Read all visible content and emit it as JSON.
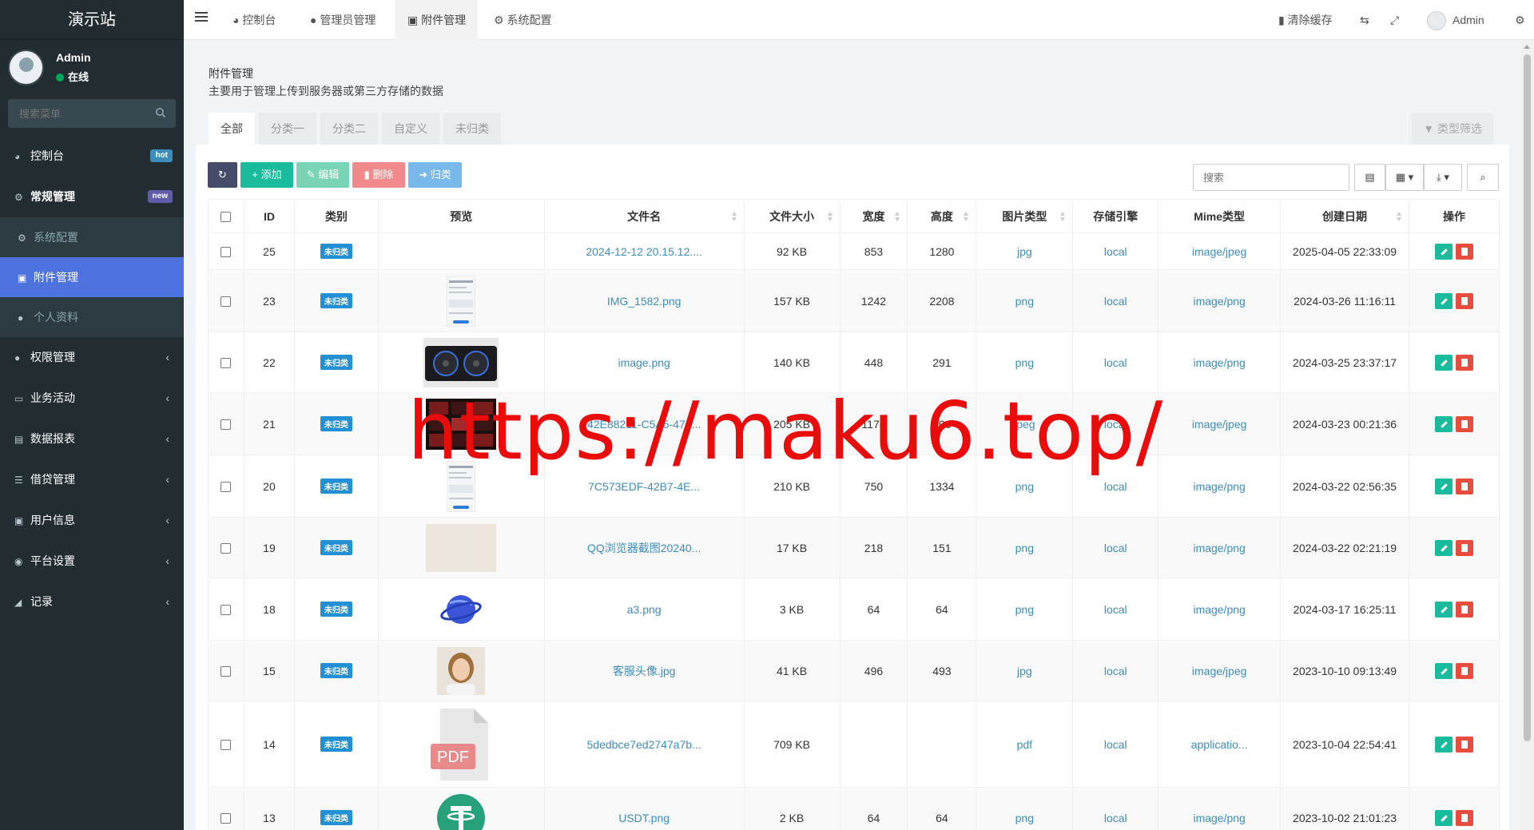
{
  "app": {
    "title": "演示站",
    "user_name": "Admin",
    "user_status": "在线"
  },
  "sidebar": {
    "search_placeholder": "搜索菜单",
    "items": [
      {
        "label": "控制台",
        "icon": "dashboard-icon",
        "badge": "hot"
      },
      {
        "label": "常规管理",
        "icon": "cogs-icon",
        "badge": "new"
      },
      {
        "label": "系统配置",
        "icon": "gear-icon"
      },
      {
        "label": "附件管理",
        "icon": "file-image-icon"
      },
      {
        "label": "个人资料",
        "icon": "user-icon"
      },
      {
        "label": "权限管理",
        "icon": "group-icon"
      },
      {
        "label": "业务活动",
        "icon": "id-card-icon"
      },
      {
        "label": "数据报表",
        "icon": "file-icon"
      },
      {
        "label": "借贷管理",
        "icon": "list-icon"
      },
      {
        "label": "用户信息",
        "icon": "address-book-icon"
      },
      {
        "label": "平台设置",
        "icon": "dot-circle-icon"
      },
      {
        "label": "记录",
        "icon": "area-chart-icon"
      }
    ]
  },
  "navbar": {
    "tabs": [
      {
        "label": "控制台",
        "icon": "dashboard-icon"
      },
      {
        "label": "管理员管理",
        "icon": "user-icon"
      },
      {
        "label": "附件管理",
        "icon": "file-image-icon"
      },
      {
        "label": "系统配置",
        "icon": "gear-icon"
      }
    ],
    "clear_cache": "清除缓存",
    "user": "Admin"
  },
  "page": {
    "title": "附件管理",
    "description": "主要用于管理上传到服务器或第三方存储的数据",
    "category_tabs": [
      "全部",
      "分类一",
      "分类二",
      "自定义",
      "未归类"
    ],
    "type_filter": "类型筛选",
    "toolbar": {
      "add": "添加",
      "edit": "编辑",
      "delete": "删除",
      "classify": "归类"
    },
    "search_placeholder": "搜索"
  },
  "table": {
    "columns": [
      "ID",
      "类别",
      "预览",
      "文件名",
      "文件大小",
      "宽度",
      "高度",
      "图片类型",
      "存储引擎",
      "Mime类型",
      "创建日期",
      "操作"
    ],
    "rows": [
      {
        "id": "25",
        "category": "未归类",
        "preview": "none",
        "filename": "2024-12-12 20.15.12....",
        "size": "92 KB",
        "width": "853",
        "height": "1280",
        "type": "jpg",
        "storage": "local",
        "mime": "image/jpeg",
        "created": "2025-04-05 22:33:09"
      },
      {
        "id": "23",
        "category": "未归类",
        "preview": "phone-screenshot",
        "filename": "IMG_1582.png",
        "size": "157 KB",
        "width": "1242",
        "height": "2208",
        "type": "png",
        "storage": "local",
        "mime": "image/png",
        "created": "2024-03-26 11:16:11"
      },
      {
        "id": "22",
        "category": "未归类",
        "preview": "graphics-card",
        "filename": "image.png",
        "size": "140 KB",
        "width": "448",
        "height": "291",
        "type": "png",
        "storage": "local",
        "mime": "image/png",
        "created": "2024-03-25 23:37:17"
      },
      {
        "id": "21",
        "category": "未归类",
        "preview": "dark-grid",
        "filename": "42E88211-C5A5-470...",
        "size": "205 KB",
        "width": "1170",
        "height": "806",
        "type": "jpeg",
        "storage": "local",
        "mime": "image/jpeg",
        "created": "2024-03-23 00:21:36"
      },
      {
        "id": "20",
        "category": "未归类",
        "preview": "phone-screenshot",
        "filename": "7C573EDF-42B7-4E...",
        "size": "210 KB",
        "width": "750",
        "height": "1334",
        "type": "png",
        "storage": "local",
        "mime": "image/png",
        "created": "2024-03-22 02:56:35"
      },
      {
        "id": "19",
        "category": "未归类",
        "preview": "beige",
        "filename": "QQ浏览器截图20240...",
        "size": "17 KB",
        "width": "218",
        "height": "151",
        "type": "png",
        "storage": "local",
        "mime": "image/png",
        "created": "2024-03-22 02:21:19"
      },
      {
        "id": "18",
        "category": "未归类",
        "preview": "planet",
        "filename": "a3.png",
        "size": "3 KB",
        "width": "64",
        "height": "64",
        "type": "png",
        "storage": "local",
        "mime": "image/png",
        "created": "2024-03-17 16:25:11"
      },
      {
        "id": "15",
        "category": "未归类",
        "preview": "portrait",
        "filename": "客服头像.jpg",
        "size": "41 KB",
        "width": "496",
        "height": "493",
        "type": "jpg",
        "storage": "local",
        "mime": "image/jpeg",
        "created": "2023-10-10 09:13:49"
      },
      {
        "id": "14",
        "category": "未归类",
        "preview": "pdf",
        "filename": "5dedbce7ed2747a7b...",
        "size": "709 KB",
        "width": "",
        "height": "",
        "type": "pdf",
        "storage": "local",
        "mime": "applicatio...",
        "created": "2023-10-04 22:54:41"
      },
      {
        "id": "13",
        "category": "未归类",
        "preview": "usdt",
        "filename": "USDT.png",
        "size": "2 KB",
        "width": "64",
        "height": "64",
        "type": "png",
        "storage": "local",
        "mime": "image/png",
        "created": "2023-10-02 21:01:23"
      }
    ]
  },
  "pdf_label": "PDF",
  "watermark": "https://maku6.top/",
  "colors": {
    "sidebar_bg": "#222d32",
    "active_menu": "#4e73df",
    "link": "#3c8dbc",
    "success": "#18bc9c",
    "danger": "#e74c3c",
    "watermark": "#ea0b0b"
  }
}
